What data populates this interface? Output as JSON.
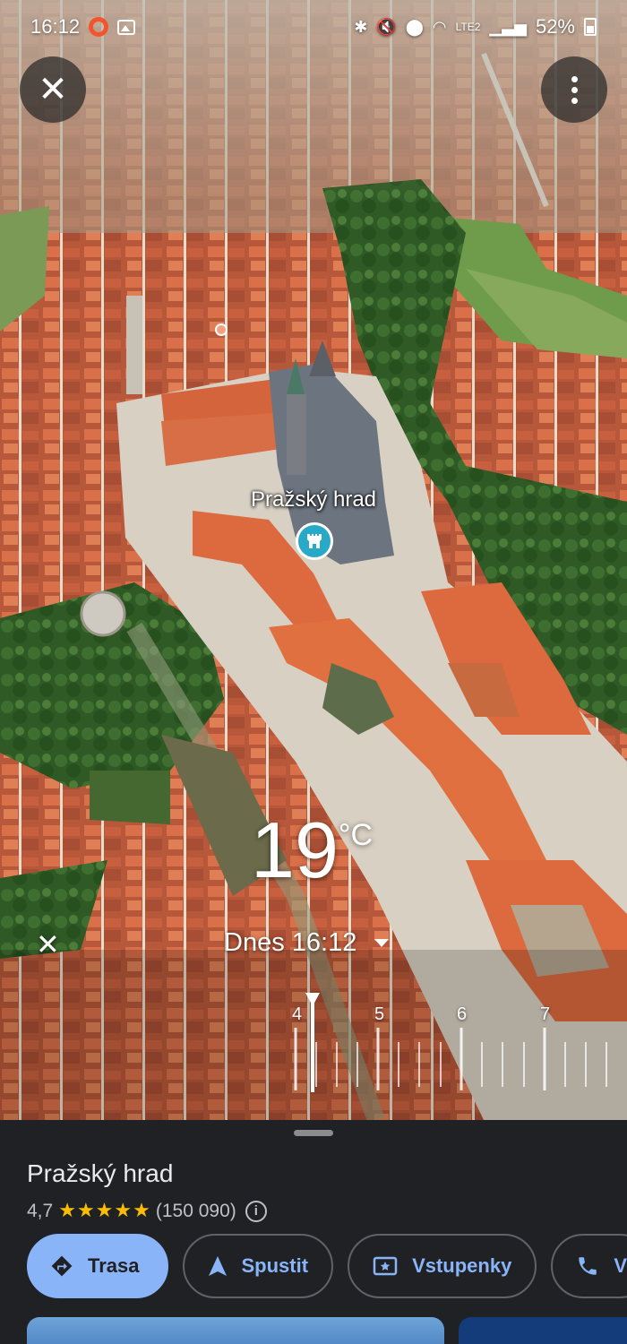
{
  "status_bar": {
    "time": "16:12",
    "network": "LTE2",
    "battery": "52%"
  },
  "top_buttons": {
    "close_icon": "close-icon",
    "more_icon": "more-vert-icon"
  },
  "place_marker": {
    "label": "Pražský hrad",
    "icon": "castle-icon",
    "color": "#28a9c7"
  },
  "weather": {
    "temperature": "19",
    "unit": "°C"
  },
  "time_control": {
    "label": "Dnes 16:12",
    "ticks": [
      "4",
      "5",
      "6",
      "7"
    ]
  },
  "place_sheet": {
    "title": "Pražský hrad",
    "rating": "4,7",
    "stars": 4.7,
    "reviews": "(150 090)",
    "actions": [
      {
        "label": "Trasa",
        "icon": "directions-icon"
      },
      {
        "label": "Spustit",
        "icon": "navigation-icon"
      },
      {
        "label": "Vstupenky",
        "icon": "ticket-icon"
      },
      {
        "label": "V",
        "icon": "phone-icon"
      }
    ]
  },
  "colors": {
    "accent": "#8ab4f8",
    "sheet_bg": "#202124",
    "star": "#fbbc04"
  }
}
